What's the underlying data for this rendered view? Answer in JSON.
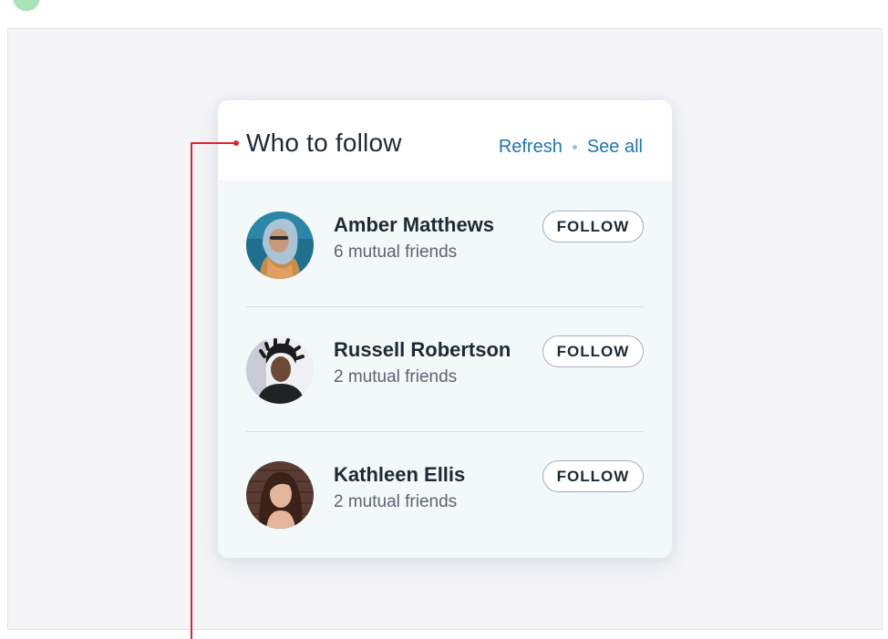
{
  "widget": {
    "title": "Who to follow",
    "refresh_label": "Refresh",
    "see_all_label": "See all"
  },
  "suggestions": [
    {
      "name": "Amber Matthews",
      "mutual": "6 mutual friends",
      "button": "FOLLOW"
    },
    {
      "name": "Russell Robertson",
      "mutual": "2 mutual friends",
      "button": "FOLLOW"
    },
    {
      "name": "Kathleen Ellis",
      "mutual": "2 mutual friends",
      "button": "FOLLOW"
    }
  ],
  "colors": {
    "link": "#1a78b0",
    "annotation": "#e0232f",
    "card_body": "#f3f8f9",
    "canvas": "#f5f5f8"
  }
}
